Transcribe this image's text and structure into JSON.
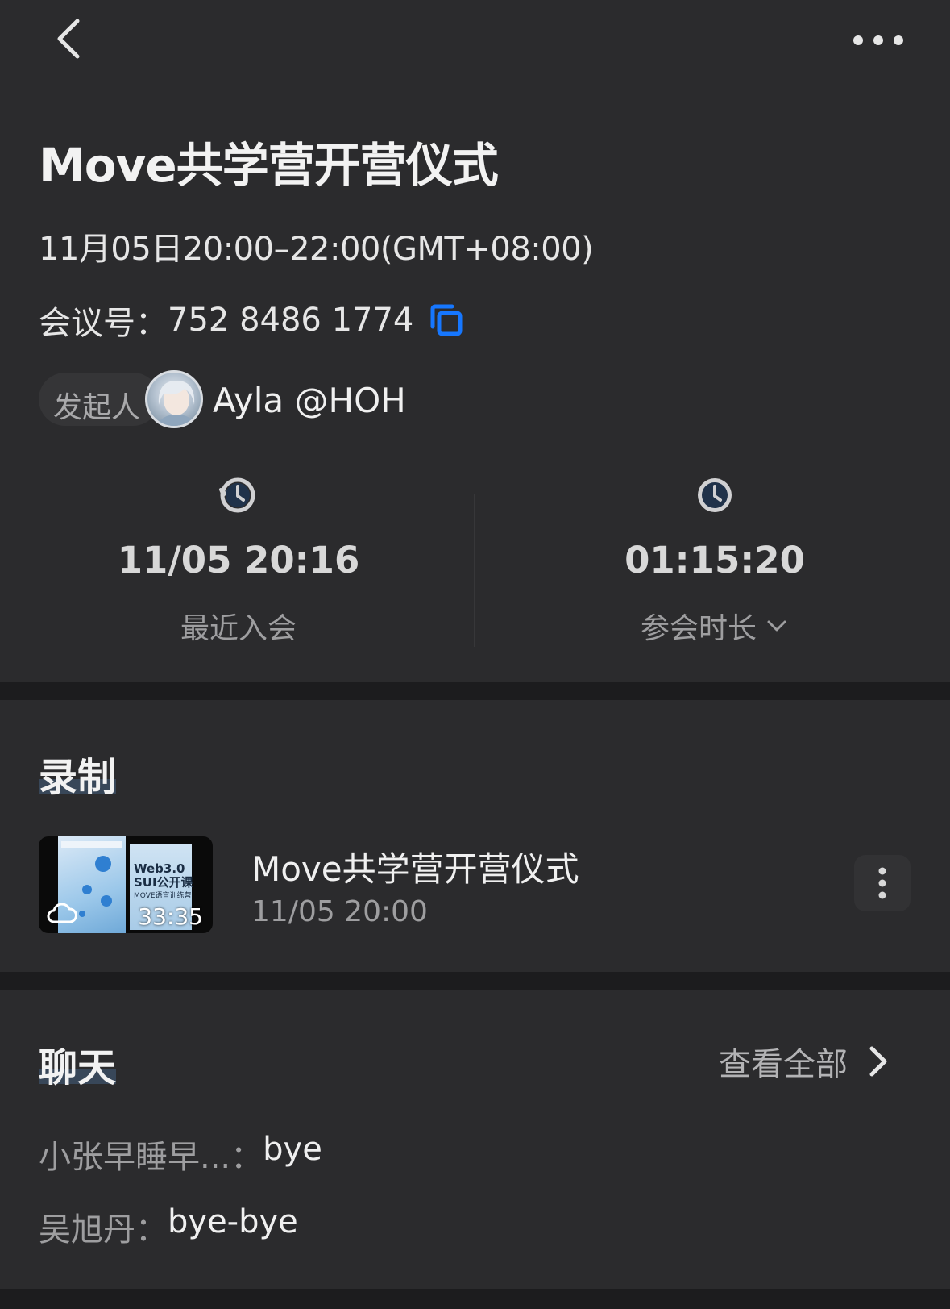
{
  "header": {
    "back_icon": "chevron-left-icon",
    "more_icon": "more-horizontal-icon"
  },
  "meeting": {
    "title": "Move共学营开营仪式",
    "time_range": "11月05日20:00–22:00(GMT+08:00)",
    "id_label": "会议号：",
    "id_value": "752 8486 1774",
    "copy_icon": "copy-icon",
    "copy_color": "#1677ff",
    "host_label": "发起人",
    "host_name": "Ayla @HOH"
  },
  "stats": {
    "last_join_value": "11/05 20:16",
    "last_join_label": "最近入会",
    "duration_value": "01:15:20",
    "duration_label": "参会时长"
  },
  "recording": {
    "heading": "录制",
    "item": {
      "title": "Move共学营开营仪式",
      "time": "11/05 20:00",
      "duration": "33:35",
      "thumb_text_1": "Web3.0",
      "thumb_text_2": "SUI公开课",
      "thumb_text_3": "MOVE语言训练营"
    }
  },
  "chat": {
    "heading": "聊天",
    "view_all": "查看全部",
    "messages": [
      {
        "sender": "小张早睡早...：",
        "text": "bye"
      },
      {
        "sender": "吴旭丹：",
        "text": "bye-bye"
      }
    ]
  }
}
